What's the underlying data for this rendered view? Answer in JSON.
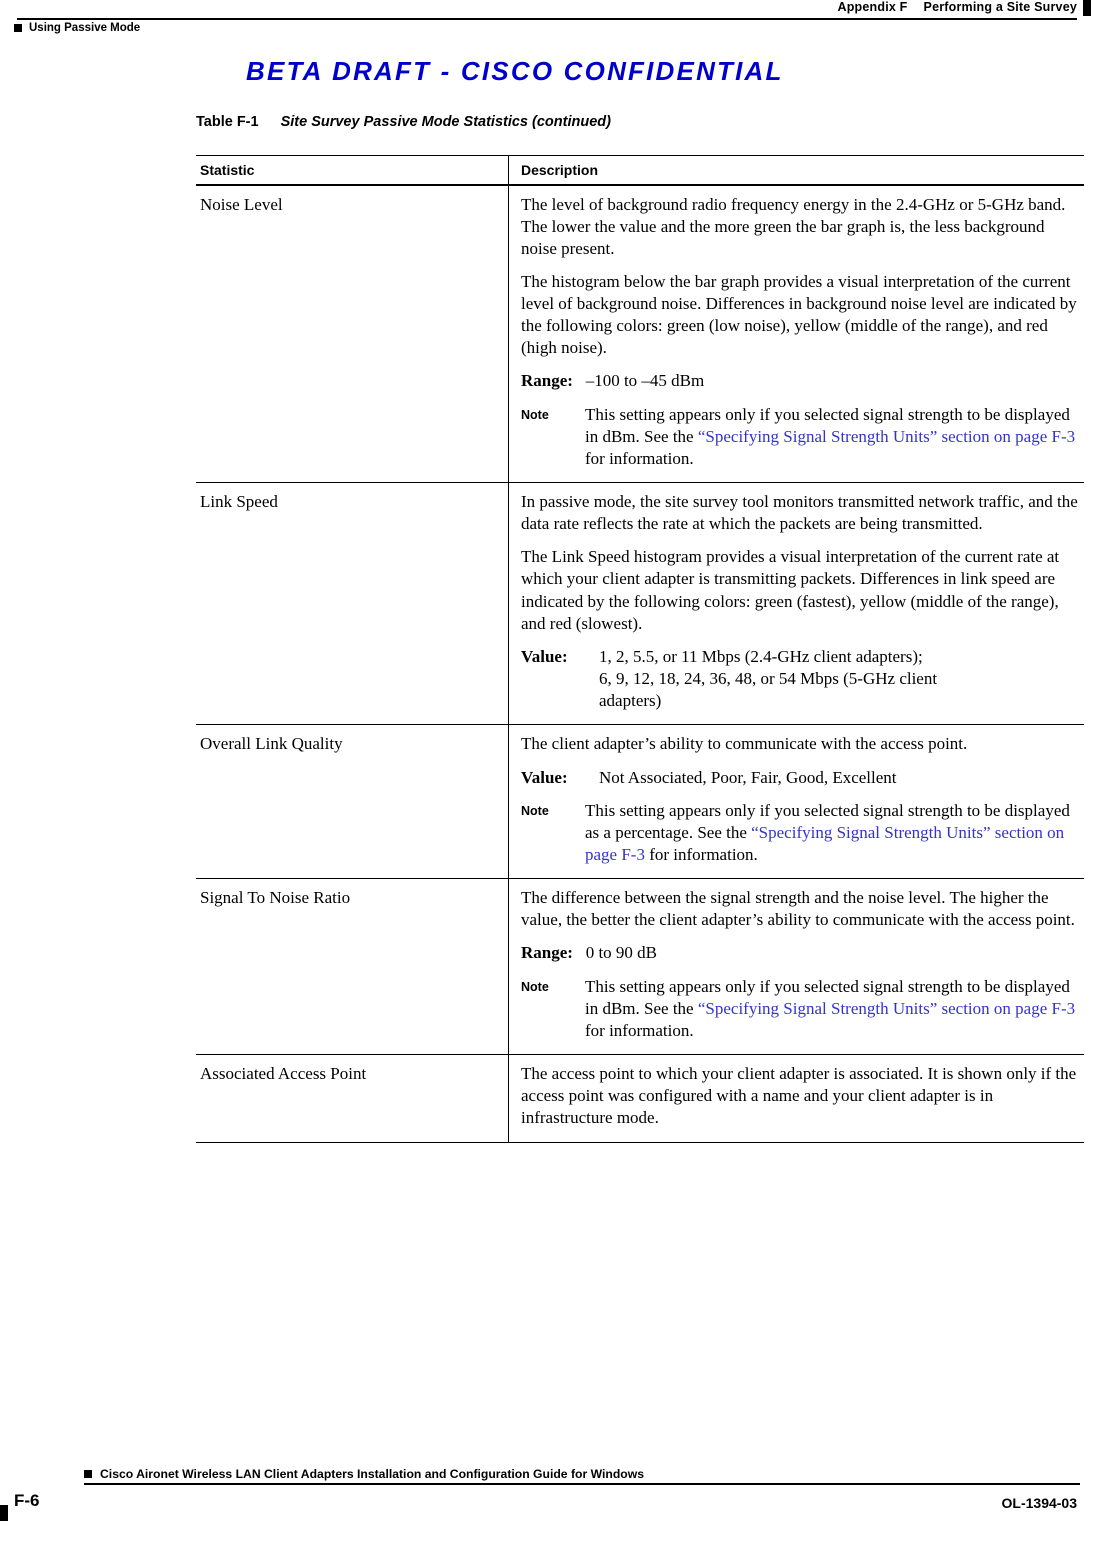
{
  "header": {
    "appendix": "Appendix F",
    "chapter": "Performing a Site Survey",
    "section": "Using Passive Mode"
  },
  "banner": {
    "text": "BETA DRAFT - CISCO CONFIDENTIAL"
  },
  "table": {
    "caption_number": "Table F-1",
    "caption_title": "Site Survey Passive Mode Statistics (continued)",
    "columns": {
      "statistic": "Statistic",
      "description": "Description"
    },
    "rows": [
      {
        "statistic": "Noise Level",
        "p1": "The level of background radio frequency energy in the 2.4-GHz or 5-GHz band. The lower the value and the more green the bar graph is, the less background noise present.",
        "p2": "The histogram below the bar graph provides a visual interpretation of the current level of background noise. Differences in background noise level are indicated by the following colors: green (low noise), yellow (middle of the range), and red (high noise).",
        "range_label": "Range:",
        "range_value": "–100 to –45 dBm",
        "note_label": "Note",
        "note_text_1": "This setting appears only if you selected signal strength to be displayed in dBm. See the ",
        "note_link": "“Specifying Signal Strength Units” section on page F-3",
        "note_text_2": " for information."
      },
      {
        "statistic": "Link Speed",
        "p1": "In passive mode, the site survey tool monitors transmitted network traffic, and the data rate reflects the rate at which the packets are being transmitted.",
        "p2": "The Link Speed histogram provides a visual interpretation of the current rate at which your client adapter is transmitting packets. Differences in link speed are indicated by the following colors: green (fastest), yellow (middle of the range), and red (slowest).",
        "value_label": "Value:",
        "value_line1": "1, 2, 5.5, or 11 Mbps (2.4-GHz client adapters);",
        "value_line2": "6, 9, 12, 18, 24, 36, 48, or 54 Mbps (5-GHz client",
        "value_line3": "adapters)"
      },
      {
        "statistic": "Overall Link Quality",
        "p1": "The client adapter’s ability to communicate with the access point.",
        "value_label": "Value:",
        "value_text": "Not Associated, Poor, Fair, Good, Excellent",
        "note_label": "Note",
        "note_text_1": "This setting appears only if you selected signal strength to be displayed as a percentage. See the ",
        "note_link": "“Specifying Signal Strength Units” section on page F-3",
        "note_text_2": " for information."
      },
      {
        "statistic": "Signal To Noise Ratio",
        "p1": "The difference between the signal strength and the noise level. The higher the value, the better the client adapter’s ability to communicate with the access point.",
        "range_label": "Range:",
        "range_value": "0 to 90 dB",
        "note_label": "Note",
        "note_text_1": "This setting appears only if you selected signal strength to be displayed in dBm. See the ",
        "note_link": "“Specifying Signal Strength Units” section on page F-3",
        "note_text_2": " for information."
      },
      {
        "statistic": "Associated Access Point",
        "p1": "The access point to which your client adapter is associated. It is shown only if the access point was configured with a name and your client adapter is in infrastructure mode."
      }
    ]
  },
  "footer": {
    "title": "Cisco Aironet Wireless LAN Client Adapters Installation and Configuration Guide for Windows",
    "page": "F-6",
    "doc_number": "OL-1394-03"
  }
}
